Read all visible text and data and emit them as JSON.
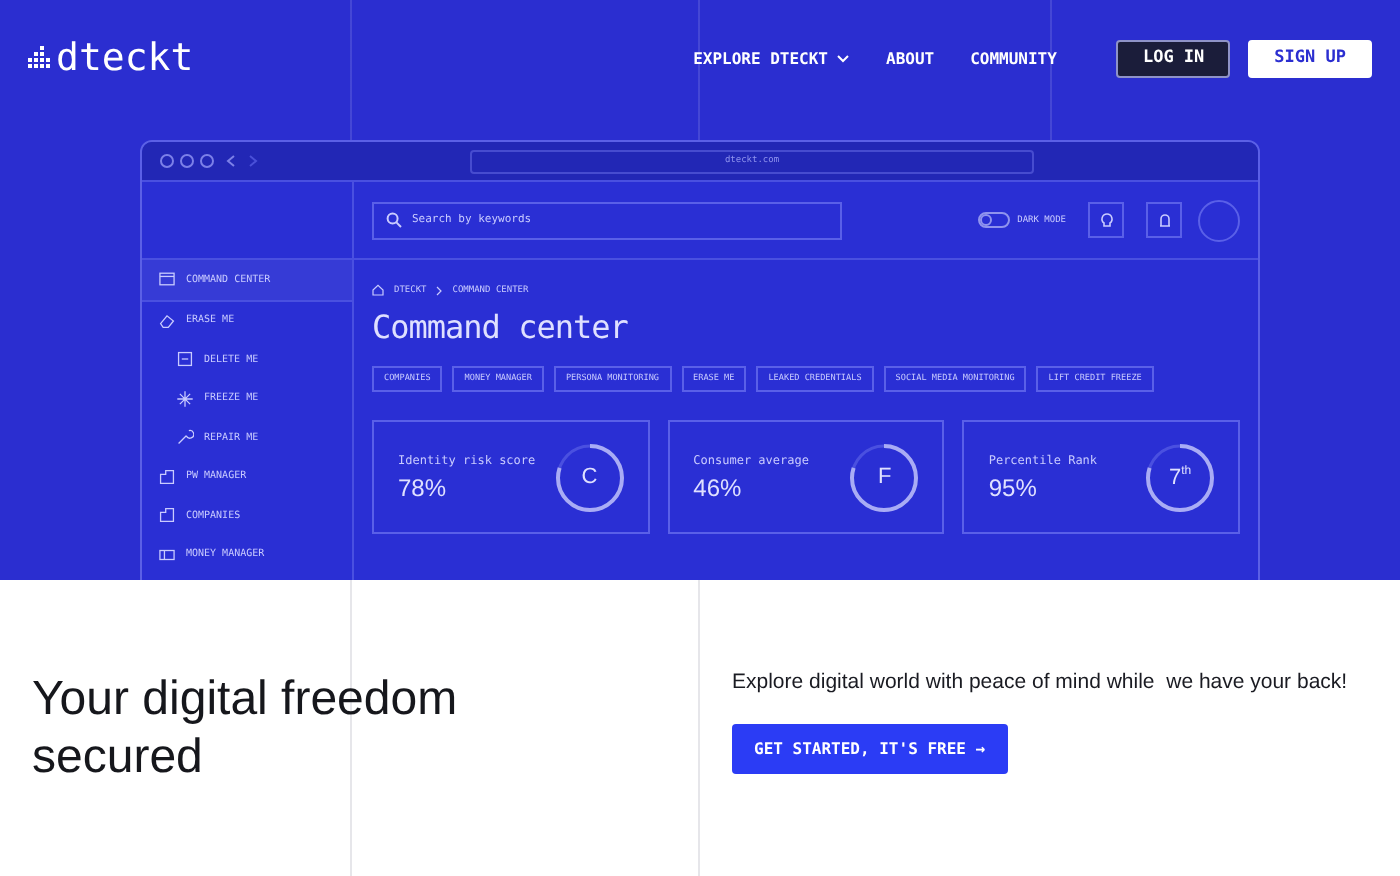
{
  "header": {
    "logo": "dteckt",
    "nav": [
      {
        "label": "EXPLORE DTECKT",
        "kind": "dropdown"
      },
      {
        "label": "ABOUT",
        "kind": "link"
      },
      {
        "label": "COMMUNITY",
        "kind": "link"
      }
    ],
    "login": "LOG IN",
    "signup": "SIGN UP"
  },
  "mockup": {
    "url": "dteckt.com",
    "search": {
      "placeholder": "Search by keywords"
    },
    "dark_mode": {
      "label": "DARK MODE",
      "on": false
    },
    "sidebar": [
      {
        "label": "COMMAND CENTER",
        "selected": true
      },
      {
        "label": "ERASE ME",
        "selected": false,
        "children": [
          {
            "label": "DELETE ME",
            "selected": false
          },
          {
            "label": "FREEZE ME",
            "selected": false
          },
          {
            "label": "REPAIR ME",
            "selected": false
          }
        ]
      },
      {
        "label": "PW MANAGER",
        "selected": false
      },
      {
        "label": "COMPANIES",
        "selected": false
      },
      {
        "label": "MONEY MANAGER",
        "selected": false
      }
    ],
    "breadcrumb": [
      "DTECKT",
      "COMMAND CENTER"
    ],
    "title": "Command center",
    "tags": [
      "COMPANIES",
      "MONEY MANAGER",
      "PERSONA MONITORING",
      "ERASE ME",
      "LEAKED CREDENTIALS",
      "SOCIAL MEDIA MONITORING",
      "LIFT CREDIT FREEZE"
    ],
    "cards": [
      {
        "label": "Identity risk score",
        "value": "78%",
        "badge": "C"
      },
      {
        "label": "Consumer average",
        "value": "46%",
        "badge": "F"
      },
      {
        "label": "Percentile Rank",
        "value": "95%",
        "badge": "7$^{th}$"
      }
    ]
  },
  "hero": {
    "headline": "Your digital freedom secured",
    "tagline": "Explore digital world with peace of mind while  we have your back!",
    "cta": "GET STARTED, IT'S FREE →"
  }
}
